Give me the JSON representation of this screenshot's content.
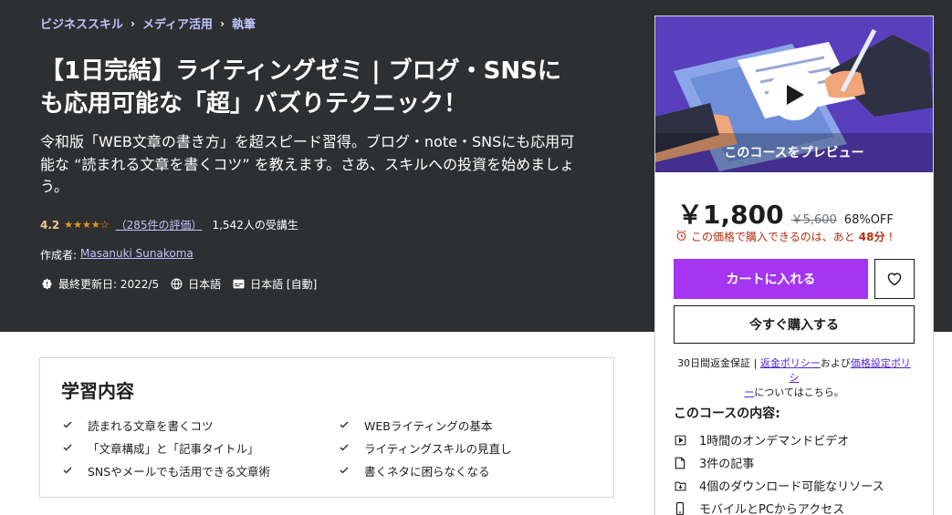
{
  "breadcrumb": {
    "items": [
      "ビジネススキル",
      "メディア活用",
      "執筆"
    ],
    "separator": "›"
  },
  "course": {
    "title_line1": "【1日完結】ライティングゼミ | ブログ・SNSに",
    "title_line2": "も応用可能な「超」バズりテクニック！",
    "subtitle_line1": "令和版「WEB文章の書き方」を超スピード習得。ブログ・note・SNSにも応用可",
    "subtitle_line2": "能な “読まれる文章を書くコツ” を教えます。さあ、スキルへの投資を始めましょ",
    "subtitle_line3": "う。",
    "rating": "4.2",
    "stars": "★★★★☆",
    "rating_count": "（285件の評価）",
    "students": "1,542人の受講生",
    "author_label": "作成者:",
    "author_name": "Masanuki Sunakoma",
    "last_updated": "最終更新日: 2022/5",
    "language": "日本語",
    "captions": "日本語 [自動]"
  },
  "sidebar": {
    "preview_label": "このコースをプレビュー",
    "price_now": "￥1,800",
    "price_original": "￥5,600",
    "discount": "68%OFF",
    "timer_text": "この価格で購入できるのは、あと",
    "timer_remaining": "48分",
    "timer_suffix": "!",
    "add_to_cart": "カートに入れる",
    "buy_now": "今すぐ購入する",
    "guarantee_prefix": "30日間返金保証 | ",
    "refund_policy": "返金ポリシー",
    "and_text": "および",
    "pricing_policy": "価格設定ポリシ",
    "pricing_policy_end": "ー",
    "guarantee_suffix": "についてはこちら。",
    "includes_title": "このコースの内容:",
    "includes": [
      {
        "icon": "video-icon",
        "label": "1時間のオンデマンドビデオ"
      },
      {
        "icon": "article-icon",
        "label": "3件の記事"
      },
      {
        "icon": "download-icon",
        "label": "4個のダウンロード可能なリソース"
      },
      {
        "icon": "mobile-icon",
        "label": "モバイルとPCからアクセス"
      }
    ]
  },
  "learn": {
    "title": "学習内容",
    "items": [
      "読まれる文章を書くコツ",
      "WEBライティングの基本",
      "「文章構成」と「記事タイトル」",
      "ライティングスキルの見直し",
      "SNSやメールでも活用できる文章術",
      "書くネタに困らなくなる"
    ]
  },
  "colors": {
    "hero_bg": "#2d2f31",
    "accent_purple": "#a435f0",
    "link_purple": "#c0c4fc",
    "rating_gold": "#f3ca8c",
    "star_orange": "#e59819",
    "timer_red": "#b32d0f"
  }
}
